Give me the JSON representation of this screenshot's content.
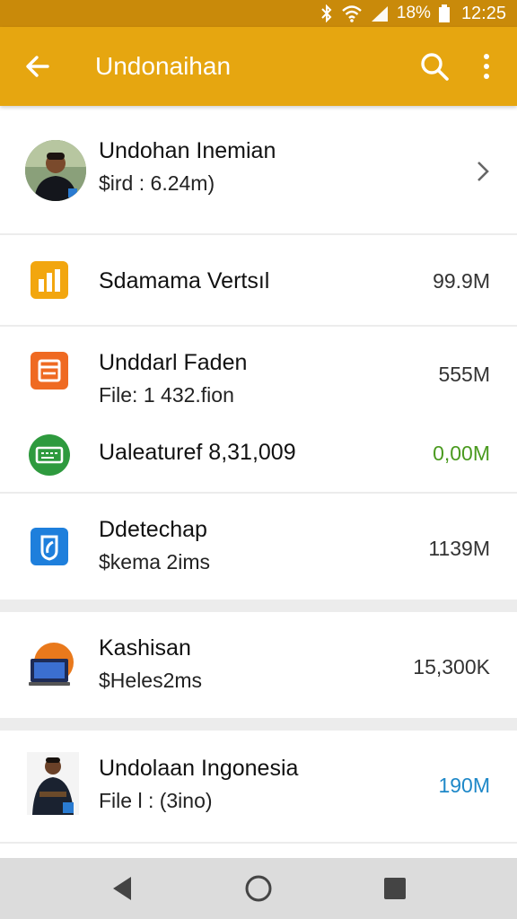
{
  "status_bar": {
    "battery_text": "18%",
    "time": "12:25"
  },
  "app_bar": {
    "title": "Undonaihan",
    "back_icon": "arrow-left-icon",
    "search_icon": "search-icon",
    "more_icon": "more-vert-icon"
  },
  "profile": {
    "name": "Undohan Inemian",
    "subtitle": "$ird : 6.24m)"
  },
  "items": [
    {
      "title": "Sdamama Vertsıl",
      "size": "99.9M",
      "icon": "bar-chart-app-icon",
      "color": "#f2a60f"
    },
    {
      "title": "Unddarl Faden",
      "subtitle": "File: 1 432.fion",
      "size": "555M",
      "icon": "document-app-icon",
      "color": "#ef6a22"
    },
    {
      "title": "Ualeaturef 8,31,009",
      "size": "0,00M",
      "icon": "ticket-app-icon",
      "color": "#2e9a3e"
    },
    {
      "title": "Ddetechap",
      "subtitle": "$kema 2ims",
      "size": "1139M",
      "icon": "shield-app-icon",
      "color": "#1e7fdc"
    },
    {
      "title": "Kashisan",
      "subtitle": "$Heles2ms",
      "size": "15,300K",
      "icon": "laptop-app-icon",
      "color": "#e9791c"
    },
    {
      "title": "Undolaan Ingonesia",
      "subtitle": "File l : (3ino)",
      "size": "190M",
      "icon": "person-photo-icon",
      "color": "#1e88c8"
    }
  ],
  "nav": {
    "back": "nav-back-icon",
    "home": "nav-home-icon",
    "recents": "nav-recents-icon"
  },
  "colors": {
    "status_bar": "#c98a0a",
    "app_bar": "#e6a610",
    "green_value": "#4a9a1f",
    "blue_value": "#1e88c8"
  }
}
